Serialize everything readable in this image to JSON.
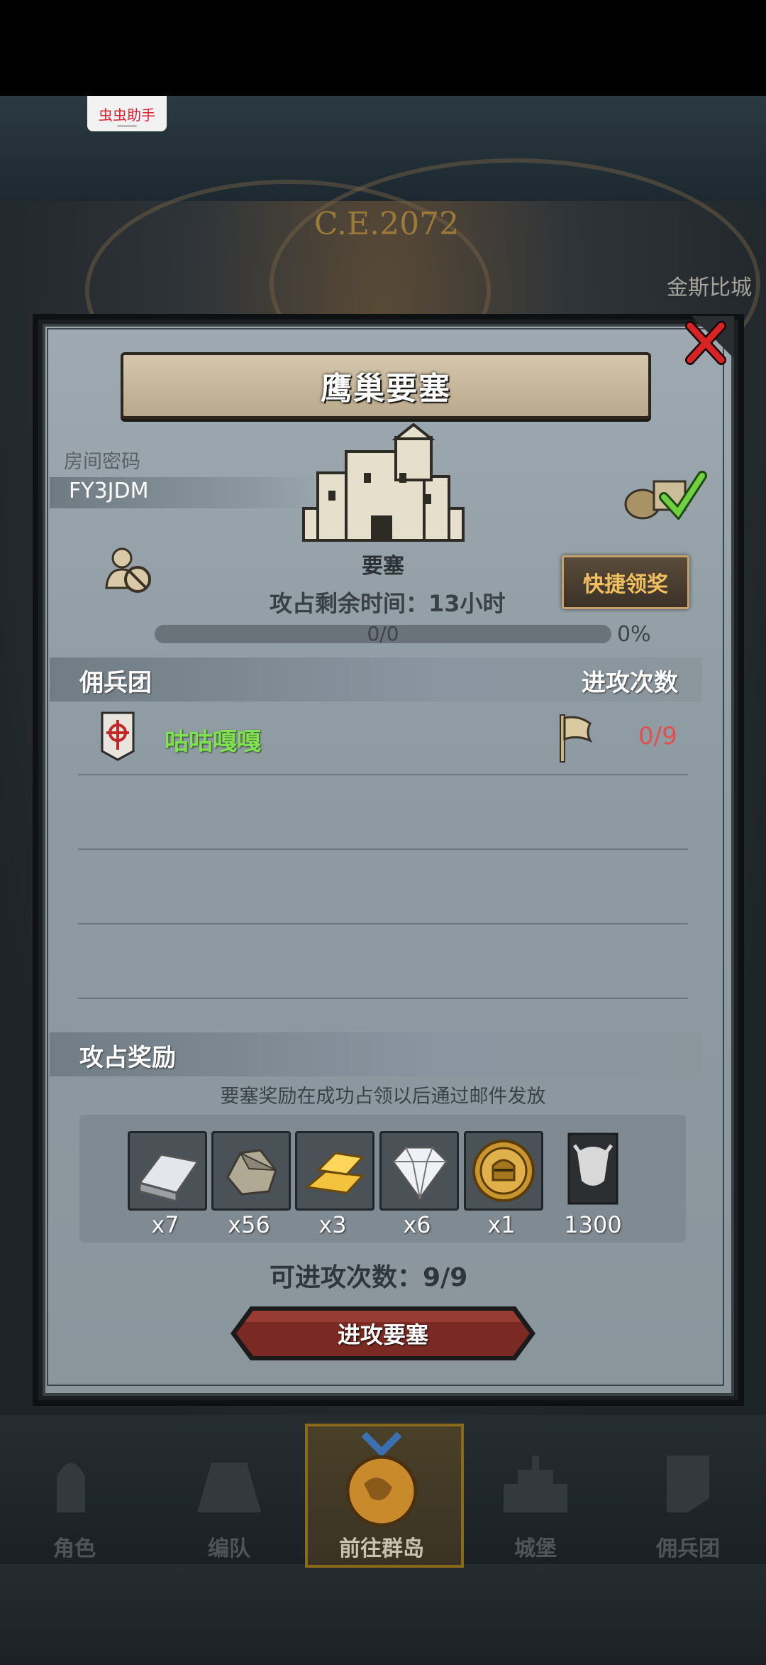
{
  "overlay": {
    "helper_label": "虫虫助手"
  },
  "background": {
    "year": "C.E.2072",
    "city_label": "金斯比城"
  },
  "modal": {
    "title": "鹰巢要塞",
    "room_label": "房间密码",
    "room_code": "FY3JDM",
    "fortress_label": "要塞",
    "quick_claim_label": "快捷领奖",
    "time_remaining": "攻占剩余时间：13小时",
    "progress_text": "0/0",
    "progress_percent": "0%",
    "progress_value": 0,
    "mercenary_header": "佣兵团",
    "attack_count_header": "进攻次数",
    "guilds": [
      {
        "name": "咕咕嘎嘎",
        "attacks": "0/9"
      }
    ],
    "reward_header": "攻占奖励",
    "reward_note": "要塞奖励在成功占领以后通过邮件发放",
    "rewards": [
      {
        "icon": "silver-ingot-icon",
        "count": "x7"
      },
      {
        "icon": "stone-icon",
        "count": "x56"
      },
      {
        "icon": "gold-bars-icon",
        "count": "x3"
      },
      {
        "icon": "diamond-icon",
        "count": "x6"
      },
      {
        "icon": "knight-coin-icon",
        "count": "x1"
      },
      {
        "icon": "bull-banner-icon",
        "count": "1300"
      }
    ],
    "remaining_attacks": "可进攻次数：9/9",
    "attack_button_label": "进攻要塞"
  },
  "nav": {
    "items": [
      {
        "label": "角色"
      },
      {
        "label": "编队"
      },
      {
        "label": "前往群岛"
      },
      {
        "label": "城堡"
      },
      {
        "label": "佣兵团"
      }
    ]
  },
  "colors": {
    "guild_name": "#7fe050",
    "attack_count": "#e05050",
    "quick_claim_text": "#f0c060",
    "modal_bg": "#9ea9b1"
  }
}
